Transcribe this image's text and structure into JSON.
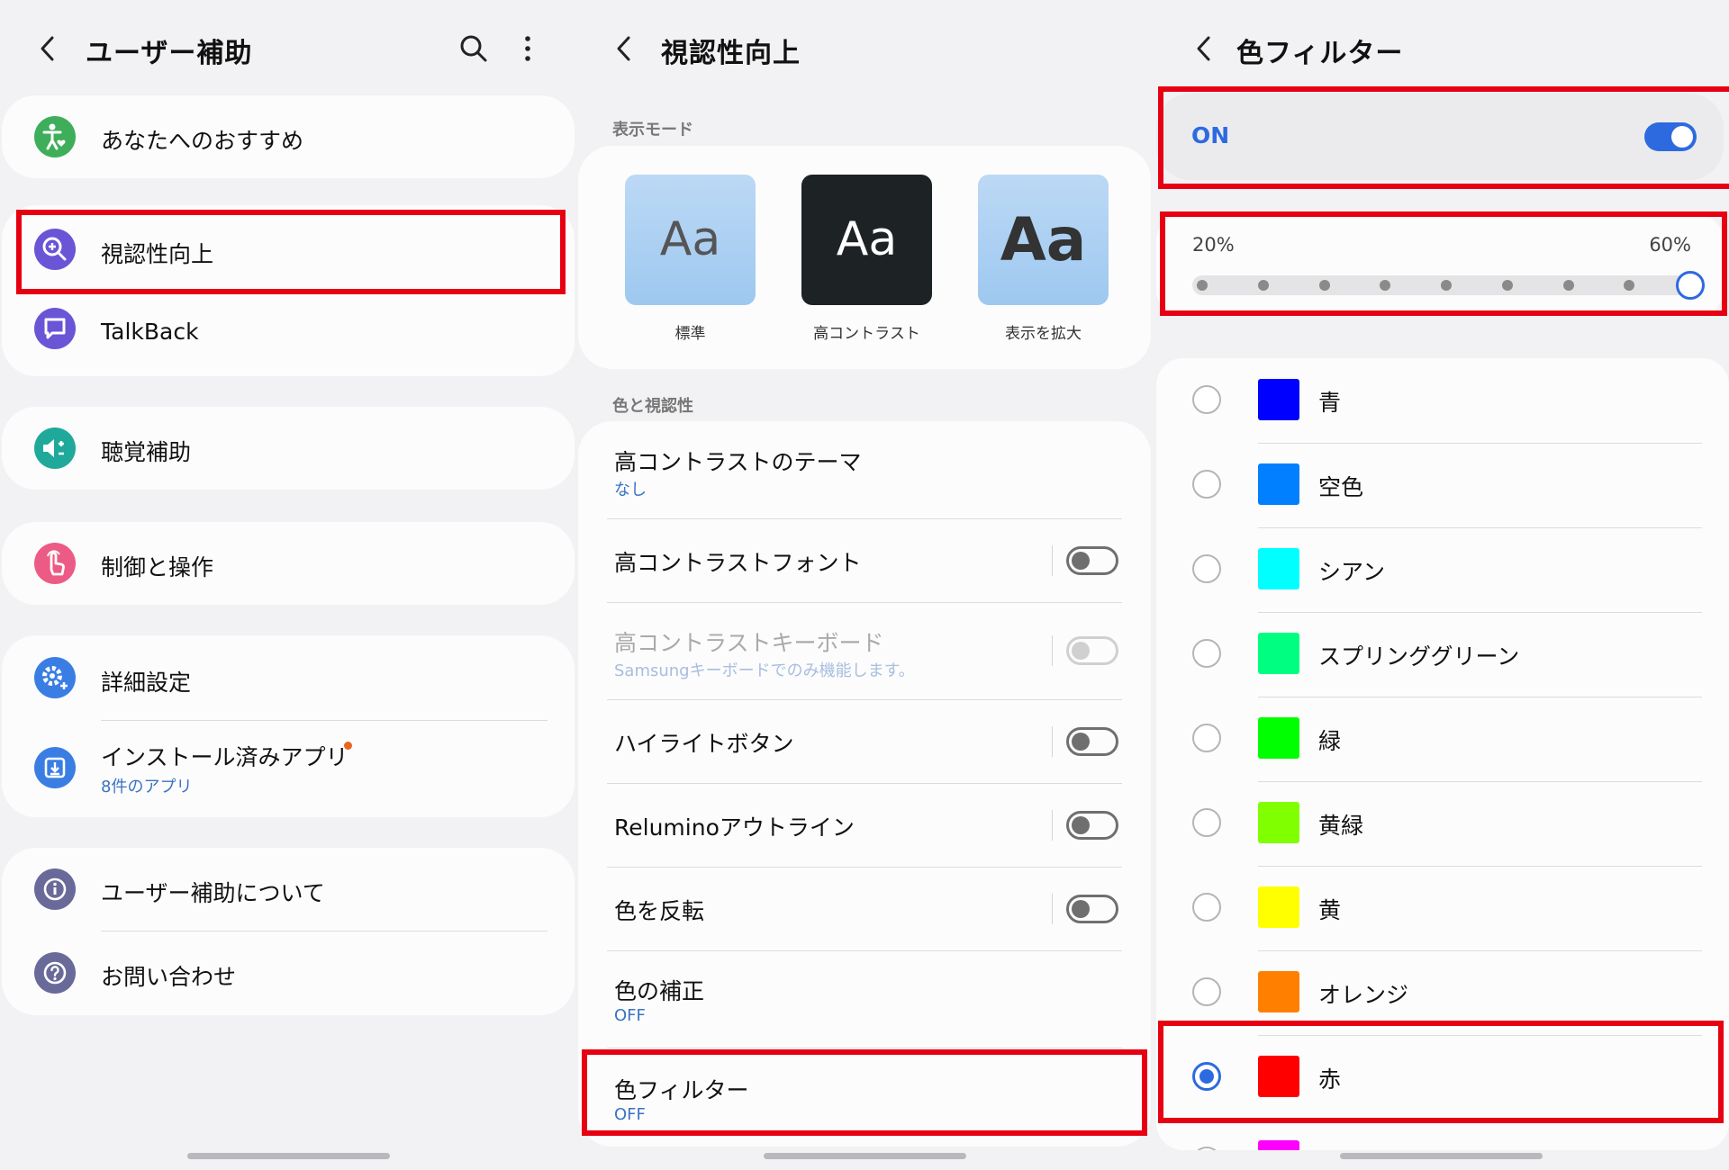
{
  "panel1": {
    "title": "ユーザー補助",
    "items": [
      {
        "label": "あなたへのおすすめ",
        "icon": "accessibility-person-icon",
        "color": "#3eae5a"
      },
      {
        "label": "視認性向上",
        "icon": "zoom-in-icon",
        "color": "#6a55d6"
      },
      {
        "label": "TalkBack",
        "icon": "chat-square-icon",
        "color": "#6a55d6"
      },
      {
        "label": "聴覚補助",
        "icon": "volume-plus-minus-icon",
        "color": "#1fa99a"
      },
      {
        "label": "制御と操作",
        "icon": "touch-hand-icon",
        "color": "#ec5b85"
      },
      {
        "label": "詳細設定",
        "icon": "gear-plus-icon",
        "color": "#3a7ee4"
      },
      {
        "label": "インストール済みアプリ",
        "sub": "8件のアプリ",
        "icon": "download-icon",
        "color": "#3a7ee4"
      },
      {
        "label": "ユーザー補助について",
        "icon": "info-icon",
        "color": "#6a6a9a"
      },
      {
        "label": "お問い合わせ",
        "icon": "help-icon",
        "color": "#6a6a9a"
      }
    ],
    "badge_color": "#e8661d"
  },
  "panel2": {
    "title": "視認性向上",
    "section_display": "表示モード",
    "modes": [
      {
        "glyph": "Aa",
        "label": "標準"
      },
      {
        "glyph": "Aa",
        "label": "高コントラスト"
      },
      {
        "glyph": "Aa",
        "label": "表示を拡大"
      }
    ],
    "section_color": "色と視認性",
    "rows": [
      {
        "label": "高コントラストのテーマ",
        "sub": "なし"
      },
      {
        "label": "高コントラストフォント"
      },
      {
        "label": "高コントラストキーボード",
        "sub": "Samsungキーボードでのみ機能します。"
      },
      {
        "label": "ハイライトボタン"
      },
      {
        "label": "Reluminoアウトライン"
      },
      {
        "label": "色を反転"
      },
      {
        "label": "色の補正",
        "sub": "OFF"
      },
      {
        "label": "色フィルター",
        "sub": "OFF"
      }
    ]
  },
  "panel3": {
    "title": "色フィルター",
    "on_label": "ON",
    "slider": {
      "min_label": "20%",
      "max_label": "60%",
      "steps": 9,
      "value_step": 9
    },
    "colors": [
      {
        "name": "青",
        "hex": "#0000ff"
      },
      {
        "name": "空色",
        "hex": "#0080ff"
      },
      {
        "name": "シアン",
        "hex": "#00ffff"
      },
      {
        "name": "スプリンググリーン",
        "hex": "#00ff80"
      },
      {
        "name": "緑",
        "hex": "#00ff00"
      },
      {
        "name": "黄緑",
        "hex": "#80ff00"
      },
      {
        "name": "黄",
        "hex": "#ffff00"
      },
      {
        "name": "オレンジ",
        "hex": "#ff8000"
      },
      {
        "name": "赤",
        "hex": "#ff0000",
        "selected": true
      },
      {
        "name": "",
        "hex": "#ff00ff"
      }
    ],
    "accent": "#2d6ae0"
  }
}
